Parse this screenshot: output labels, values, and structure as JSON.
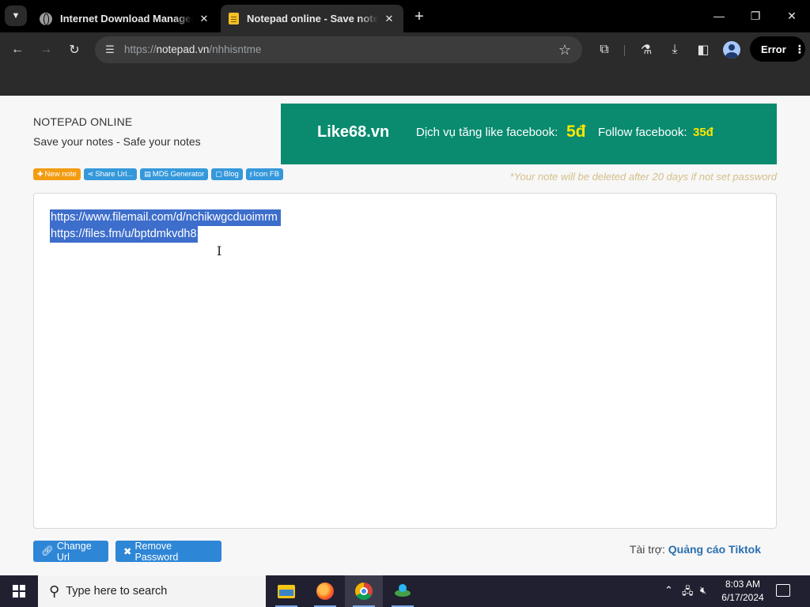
{
  "browser": {
    "tabs": [
      {
        "title": "Internet Download Manager is",
        "active": false
      },
      {
        "title": "Notepad online - Save notes online",
        "active": true
      }
    ],
    "url_scheme": "https://",
    "url_host": "notepad.vn",
    "url_path": "/nhhisntme",
    "error_label": "Error"
  },
  "page": {
    "title": "NOTEPAD ONLINE",
    "subtitle": "Save your notes - Safe your notes",
    "ad": {
      "brand": "Like68.vn",
      "text1": "Dịch vụ tăng like facebook:",
      "price1": "5đ",
      "text2": "Follow facebook:",
      "price2": "35đ"
    },
    "mini_buttons": [
      {
        "icon": "✚",
        "label": "New note",
        "color": "orange"
      },
      {
        "icon": "⋖",
        "label": "Share Url...",
        "color": "blue"
      },
      {
        "icon": "▤",
        "label": "MD5 Generator",
        "color": "blue"
      },
      {
        "icon": "▢",
        "label": "Blog",
        "color": "blue"
      },
      {
        "icon": "f",
        "label": "Icon FB",
        "color": "blue"
      }
    ],
    "delete_notice": "*Your note will be deleted after 20 days if not set password",
    "note_lines": [
      "https://www.filemail.com/d/nchikwgcduoimrm",
      "https://files.fm/u/bptdmkvdh8"
    ],
    "change_url_label": "Change Url",
    "remove_password_label": "Remove Password",
    "sponsor_prefix": "Tài trợ:",
    "sponsor_link": "Quảng cáo Tiktok"
  },
  "taskbar": {
    "search_placeholder": "Type here to search",
    "time": "8:03 AM",
    "date": "6/17/2024"
  },
  "colors": {
    "ad_background": "#0a8b6f",
    "selection": "#3d6ecb",
    "primary_button": "#2e86d6",
    "new_note_button": "#f39c12"
  }
}
